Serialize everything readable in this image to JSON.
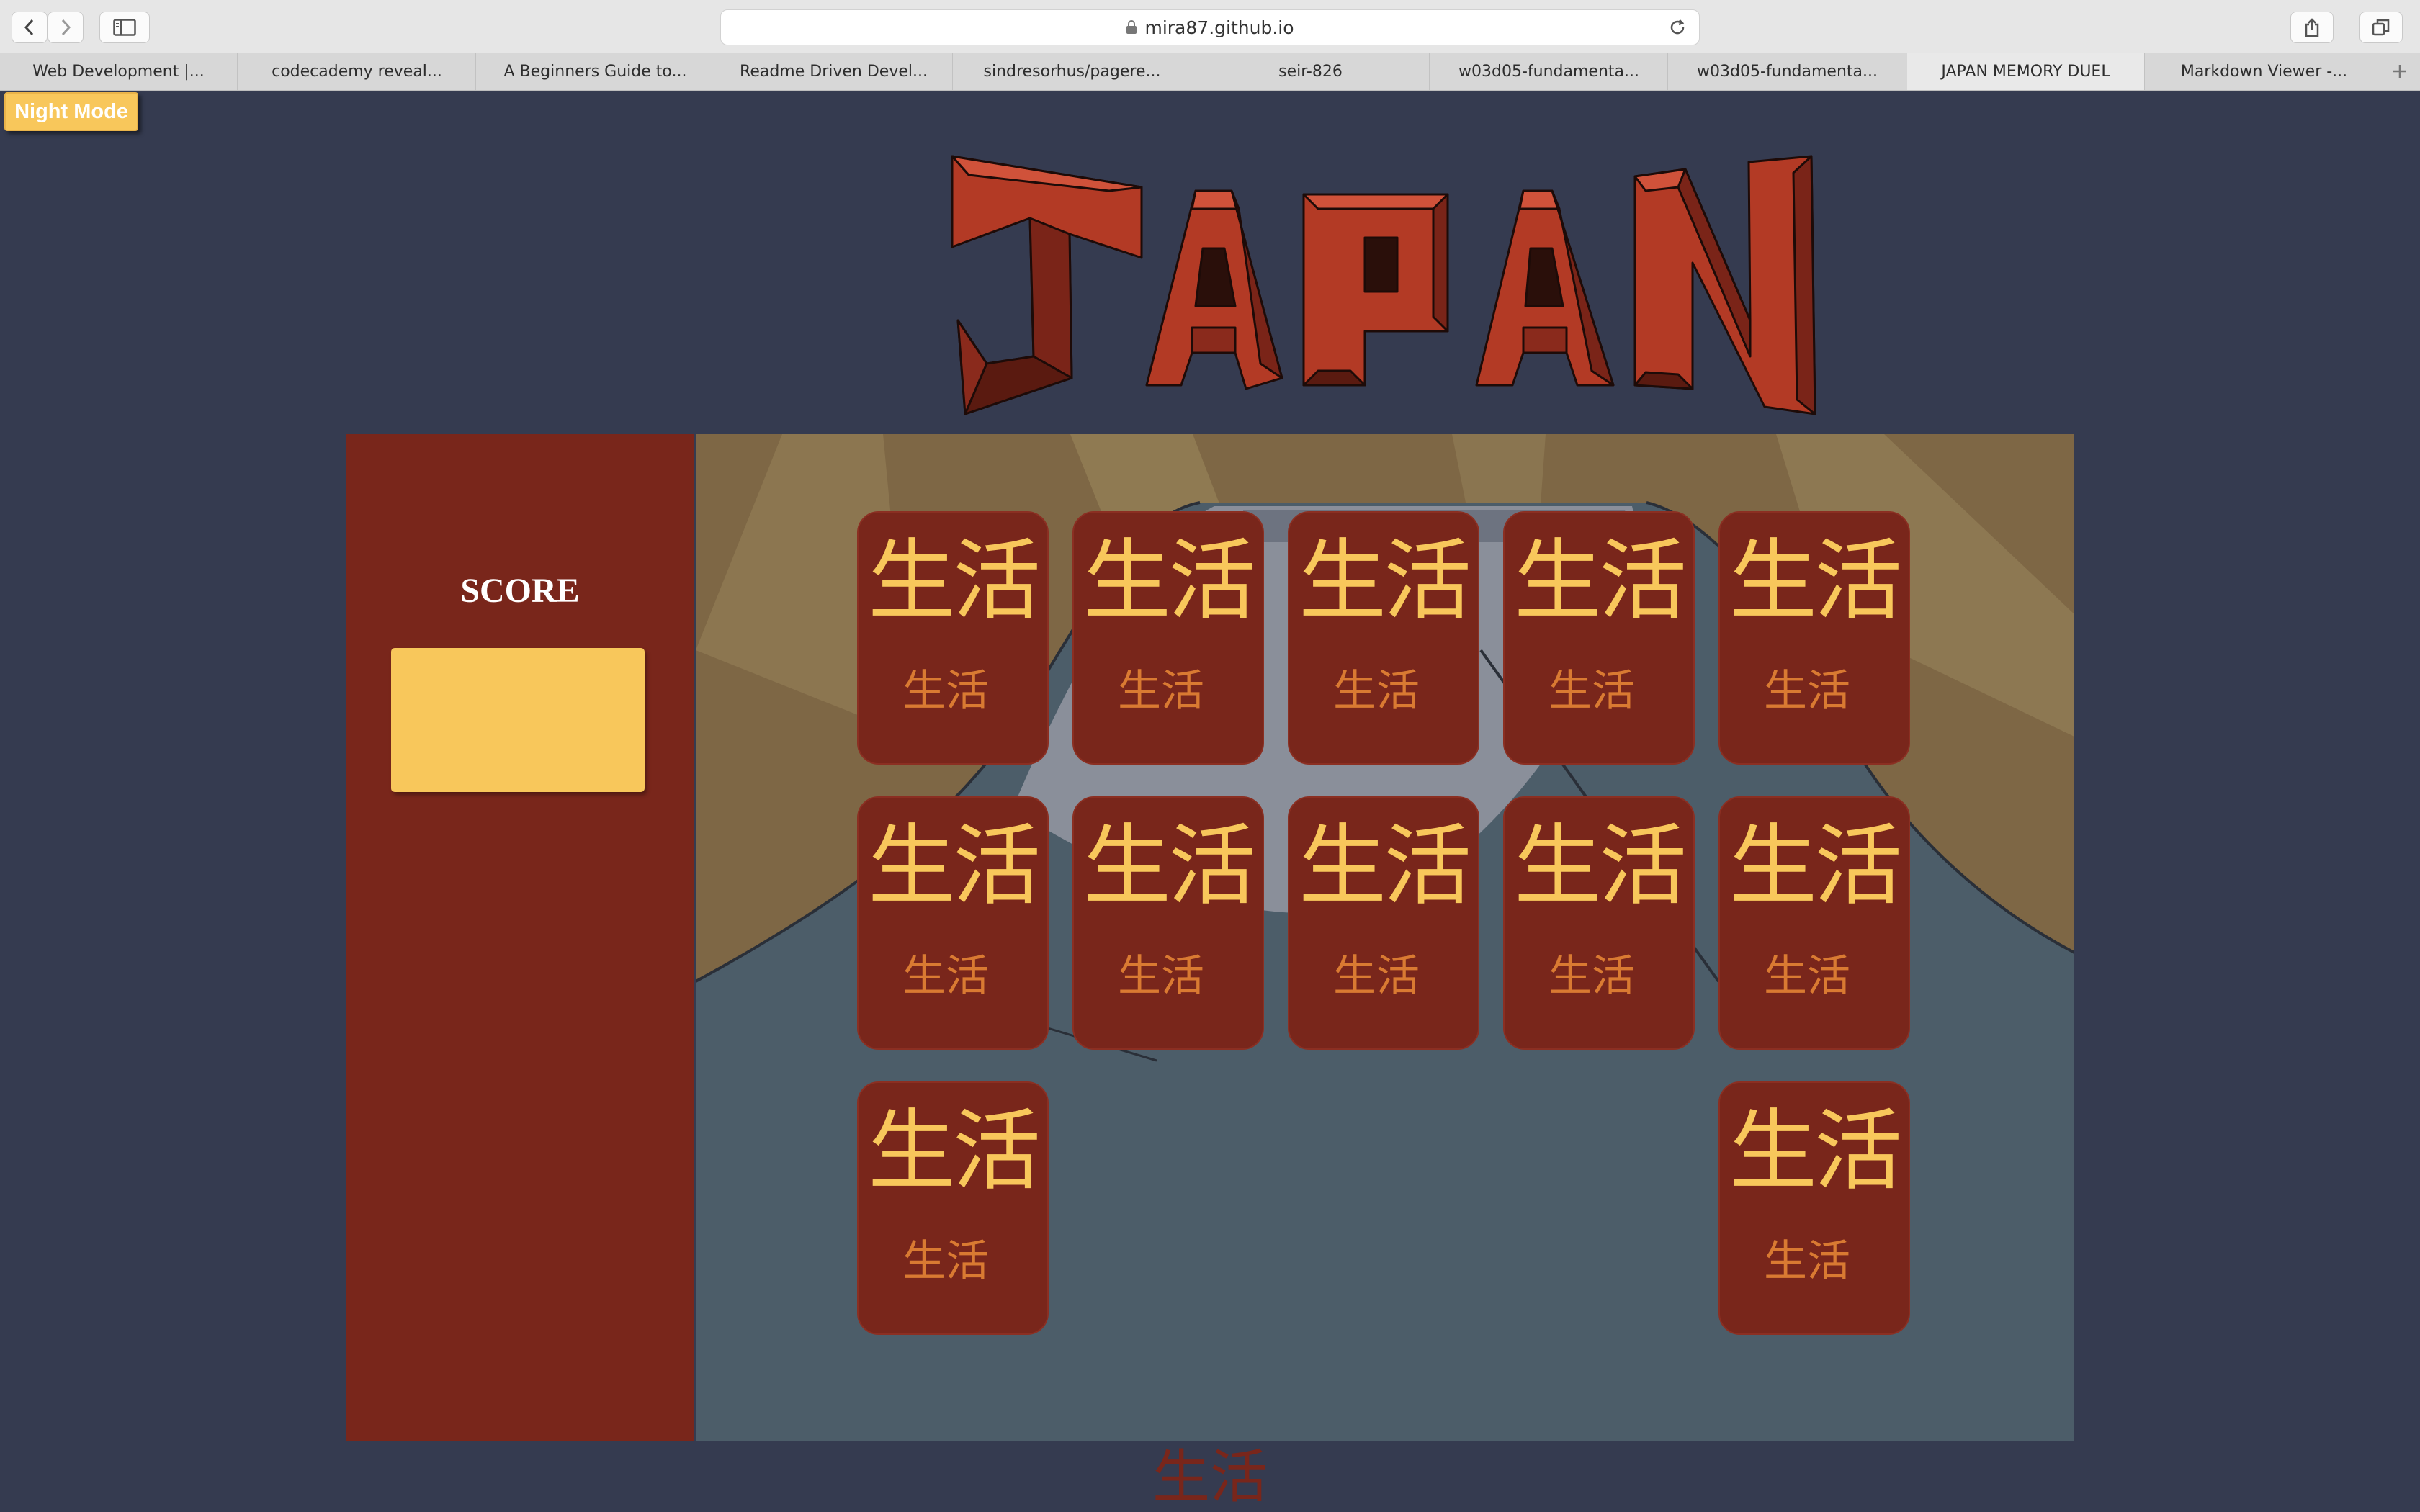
{
  "browser": {
    "url": "mira87.github.io",
    "tabs": [
      {
        "label": "Web Development |..."
      },
      {
        "label": "codecademy reveal..."
      },
      {
        "label": "A Beginners Guide to..."
      },
      {
        "label": "Readme Driven Devel..."
      },
      {
        "label": "sindresorhus/pagere..."
      },
      {
        "label": "seir-826"
      },
      {
        "label": "w03d05-fundamenta..."
      },
      {
        "label": "w03d05-fundamenta..."
      },
      {
        "label": "JAPAN MEMORY DUEL"
      },
      {
        "label": "Markdown Viewer -..."
      }
    ],
    "active_tab": 8,
    "icons": [
      "back-icon",
      "forward-icon",
      "sidebar-icon",
      "lock-icon",
      "reload-icon",
      "share-icon",
      "tabs-overview-icon",
      "new-tab-icon"
    ]
  },
  "page": {
    "night_mode_label": "Night Mode",
    "logo_text": "JAPAN",
    "score_label": "SCORE",
    "score_value": "",
    "footer_text": "生活",
    "colors": {
      "background": "#353b50",
      "card": "#79261b",
      "gold": "#f8c75b",
      "orange": "#d97a32"
    }
  },
  "cards": [
    {
      "big": "生活",
      "small": "生活"
    },
    {
      "big": "生活",
      "small": "生活"
    },
    {
      "big": "生活",
      "small": "生活"
    },
    {
      "big": "生活",
      "small": "生活"
    },
    {
      "big": "生活",
      "small": "生活"
    },
    {
      "big": "生活",
      "small": "生活"
    },
    {
      "big": "生活",
      "small": "生活"
    },
    {
      "big": "生活",
      "small": "生活"
    },
    {
      "big": "生活",
      "small": "生活"
    },
    {
      "big": "生活",
      "small": "生活"
    },
    {
      "big": "生活",
      "small": "生活"
    },
    {
      "big": "生活",
      "small": "生活"
    }
  ]
}
